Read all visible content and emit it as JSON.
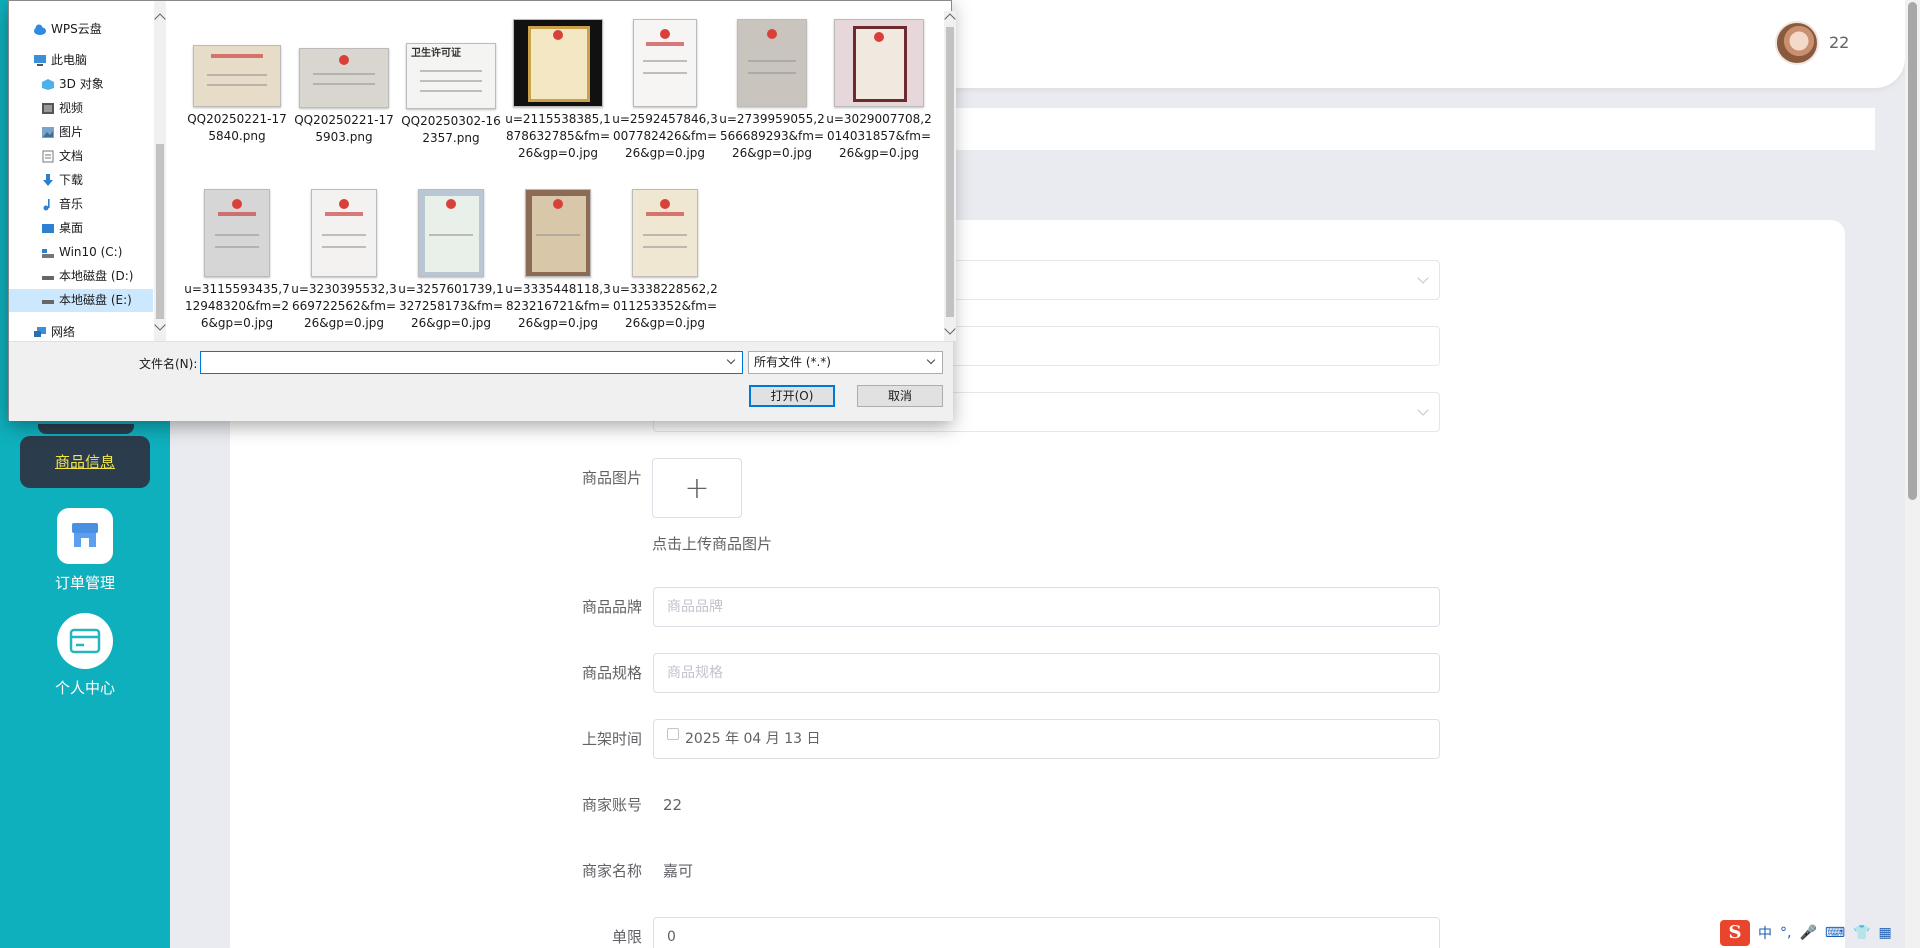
{
  "sidebar": {
    "active_label": "商品信息",
    "items": [
      {
        "label": "订单管理",
        "icon": "store-icon"
      },
      {
        "label": "个人中心",
        "icon": "card-icon"
      }
    ]
  },
  "header": {
    "user_name": "22"
  },
  "form": {
    "image_label": "商品图片",
    "upload_plus": "+",
    "upload_hint": "点击上传商品图片",
    "brand_label": "商品品牌",
    "brand_placeholder": "商品品牌",
    "spec_label": "商品规格",
    "spec_placeholder": "商品规格",
    "date_label": "上架时间",
    "date_value": "2025 年 04 月 13 日",
    "account_label": "商家账号",
    "account_value": "22",
    "merchant_label": "商家名称",
    "merchant_value": "嘉可",
    "limit_label": "单限",
    "limit_value": "0"
  },
  "dialog": {
    "nav": [
      {
        "label": "WPS云盘",
        "icon": "cloud-icon"
      },
      {
        "label": "此电脑",
        "icon": "computer-icon"
      },
      {
        "label": "3D 对象",
        "icon": "cube-icon"
      },
      {
        "label": "视频",
        "icon": "video-icon"
      },
      {
        "label": "图片",
        "icon": "picture-icon"
      },
      {
        "label": "文档",
        "icon": "document-icon"
      },
      {
        "label": "下载",
        "icon": "download-icon"
      },
      {
        "label": "音乐",
        "icon": "music-icon"
      },
      {
        "label": "桌面",
        "icon": "desktop-icon"
      },
      {
        "label": "Win10 (C:)",
        "icon": "drive-icon"
      },
      {
        "label": "本地磁盘 (D:)",
        "icon": "drive-icon"
      },
      {
        "label": "本地磁盘 (E:)",
        "icon": "drive-icon"
      },
      {
        "label": "网络",
        "icon": "network-icon"
      }
    ],
    "files": [
      {
        "name": "QQ20250221-175840.png"
      },
      {
        "name": "QQ20250221-175903.png"
      },
      {
        "name": "QQ20250302-162357.png",
        "badge": "卫生许可证"
      },
      {
        "name": "u=2115538385,1878632785&fm=26&gp=0.jpg"
      },
      {
        "name": "u=2592457846,3007782426&fm=26&gp=0.jpg"
      },
      {
        "name": "u=2739959055,2566689293&fm=26&gp=0.jpg"
      },
      {
        "name": "u=3029007708,2014031857&fm=26&gp=0.jpg"
      },
      {
        "name": "u=3115593435,712948320&fm=26&gp=0.jpg"
      },
      {
        "name": "u=3230395532,3669722562&fm=26&gp=0.jpg"
      },
      {
        "name": "u=3257601739,1327258173&fm=26&gp=0.jpg"
      },
      {
        "name": "u=3335448118,3823216721&fm=26&gp=0.jpg"
      },
      {
        "name": "u=3338228562,2011253352&fm=26&gp=0.jpg"
      }
    ],
    "filename_label": "文件名(N):",
    "filename_value": "",
    "filetype_value": "所有文件 (*.*)",
    "open_button": "打开(O)",
    "cancel_button": "取消"
  },
  "tray": {
    "ime_logo": "S",
    "ime_mode": "中"
  }
}
